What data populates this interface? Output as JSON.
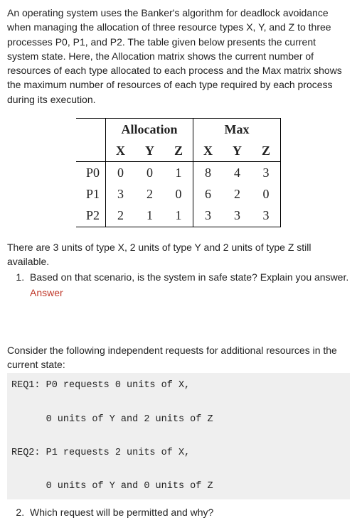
{
  "intro": "An operating system uses the Banker's algorithm for deadlock avoidance when managing the allocation of three resource types X, Y, and Z to three processes P0, P1, and P2. The table given below presents the current system state. Here, the Allocation matrix shows the current number of resources of each type allocated to each process and the Max matrix shows the maximum number of resources of each type required by each process during its execution.",
  "table": {
    "group_headers": [
      "Allocation",
      "Max"
    ],
    "sub_headers": [
      "X",
      "Y",
      "Z",
      "X",
      "Y",
      "Z"
    ],
    "rows": [
      {
        "label": "P0",
        "cells": [
          "0",
          "0",
          "1",
          "8",
          "4",
          "3"
        ]
      },
      {
        "label": "P1",
        "cells": [
          "3",
          "2",
          "0",
          "6",
          "2",
          "0"
        ]
      },
      {
        "label": "P2",
        "cells": [
          "2",
          "1",
          "1",
          "3",
          "3",
          "3"
        ]
      }
    ]
  },
  "available": "There are 3 units of type X, 2 units of type Y and 2 units of type Z still available.",
  "q1": {
    "text": "Based on that scenario, is the system in safe state? Explain you answer.",
    "answer_label": "Answer"
  },
  "consider": "Consider the following independent requests for additional resources in the current state:",
  "req": {
    "line1": "REQ1: P0 requests 0 units of X,",
    "line2": "      0 units of Y and 2 units of Z",
    "line3": "REQ2: P1 requests 2 units of X,",
    "line4": "      0 units of Y and 0 units of Z"
  },
  "q2": {
    "text": "Which request will be permitted and why?"
  }
}
